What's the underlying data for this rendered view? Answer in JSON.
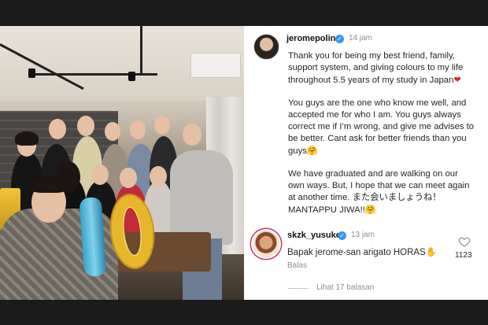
{
  "post": {
    "username": "jeromepolin",
    "time": "14 jam",
    "caption": {
      "p1": "Thank you for being my best friend, family, support system, and giving colours to my life throughout 5.5 years of my study in Japan",
      "p1_emoji": "❤",
      "p2": "You guys are the one who know me well, and accepted me for who I am. You guys always correct me if I’m wrong, and give me advises to be better. Cant ask for better friends than you guys",
      "p2_emoji": "🤗",
      "p3": "We have graduated and are walking on our own ways. But, I hope that we can meet again at another time. また会いましょうね！ MANTAPPU JIWA!!",
      "p3_emoji": "🤗"
    }
  },
  "comment": {
    "username": "skzk_yusuke",
    "time": "13 jam",
    "text": "Bapak jerome-san arigato HORAS",
    "text_emoji": "✋",
    "reply_label": "Balas",
    "likes": "1123",
    "view_replies": "Lihat 17 balasan"
  },
  "icons": {
    "verified": "verified-badge-icon",
    "like": "heart-outline-icon"
  },
  "colors": {
    "verified": "#3897f0",
    "heart": "#e0202a",
    "story_ring": "#d4346b"
  }
}
